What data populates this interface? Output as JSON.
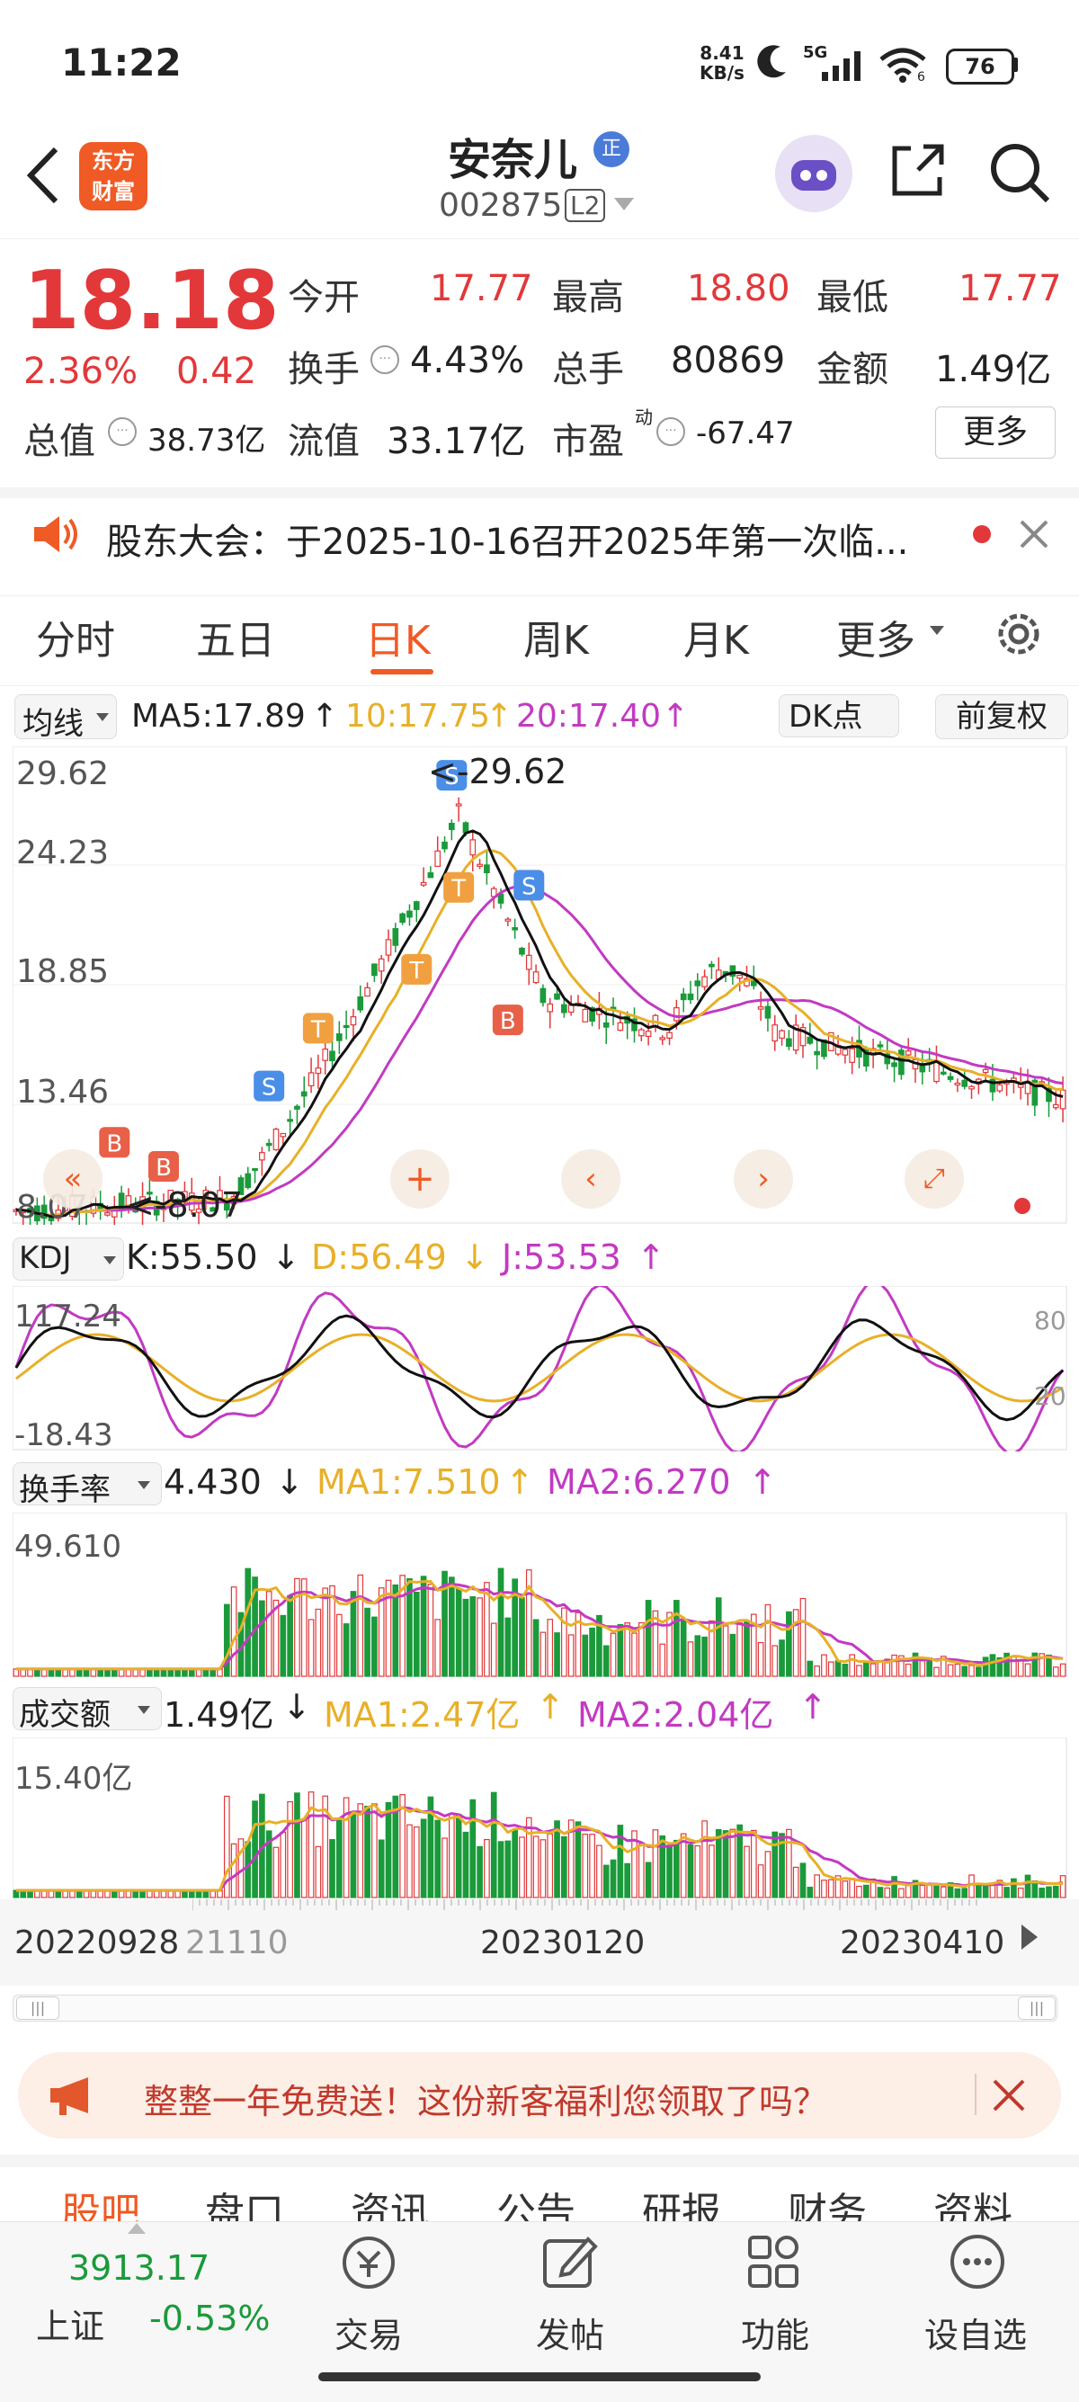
{
  "status_bar": {
    "time": "11:22",
    "net_speed_value": "8.41",
    "net_speed_unit": "KB/s",
    "signal": "5G",
    "wifi_sub": "6",
    "battery": "76"
  },
  "header": {
    "stock_name": "安奈儿",
    "stock_code": "002875",
    "level": "L2",
    "logo_line1": "东方",
    "logo_line2": "财富",
    "badge": "正"
  },
  "quote": {
    "price": "18.18",
    "change_pct": "2.36%",
    "change": "0.42",
    "open_label": "今开",
    "open": "17.77",
    "high_label": "最高",
    "high": "18.80",
    "low_label": "最低",
    "low": "17.77",
    "turnover_label": "换手",
    "turnover": "4.43%",
    "volume_label": "总手",
    "volume": "80869",
    "amount_label": "金额",
    "amount": "1.49亿",
    "mktcap_label": "总值",
    "mktcap": "38.73亿",
    "float_label": "流值",
    "float": "33.17亿",
    "pe_label": "市盈",
    "pe_sup": "动",
    "pe": "-67.47",
    "more_button": "更多"
  },
  "notice": {
    "text": "股东大会：于2025-10-16召开2025年第一次临..."
  },
  "tabs": [
    "分时",
    "五日",
    "日K",
    "周K",
    "月K",
    "更多"
  ],
  "active_tab": "日K",
  "kline": {
    "selector": "均线",
    "ma5": "MA5:17.89",
    "ma10": "10:17.75",
    "ma20": "20:17.40",
    "dk_button": "DK点",
    "adjust_button": "前复权",
    "y_labels": [
      "29.62",
      "24.23",
      "18.85",
      "13.46",
      "8.07"
    ],
    "max_label": "<-29.62",
    "min_label": "<-8.07",
    "markers": [
      "S",
      "S",
      "S",
      "B",
      "B",
      "B",
      "B",
      "T",
      "T",
      "T"
    ]
  },
  "kdj": {
    "selector": "KDJ",
    "k": "K:55.50",
    "d": "D:56.49",
    "j": "J:53.53",
    "y_top": "117.24",
    "y_bottom": "-18.43",
    "right_top": "80",
    "right_bottom": "20"
  },
  "turnover_panel": {
    "selector": "换手率",
    "value": "4.430",
    "ma1": "MA1:7.510",
    "ma2": "MA2:6.270",
    "y_top": "49.610"
  },
  "amount_panel": {
    "selector": "成交额",
    "value": "1.49亿",
    "ma1": "MA1:2.47亿",
    "ma2": "MA2:2.04亿",
    "y_top": "15.40亿"
  },
  "dates": [
    "20220928",
    "21110",
    "20230120",
    "20230410"
  ],
  "promo": {
    "text": "整整一年免费送！这份新客福利您领取了吗？"
  },
  "subtabs": [
    "股吧",
    "盘口",
    "资讯",
    "公告",
    "研报",
    "财务",
    "资料"
  ],
  "bottom_nav": {
    "index_value": "3913.17",
    "index_name": "上证",
    "index_change": "-0.53%",
    "items": [
      "交易",
      "发帖",
      "功能",
      "设自选"
    ]
  },
  "colors": {
    "up": "#e2383a",
    "down": "#1a9a3a",
    "ma10": "#e8b028",
    "ma20": "#c23ac2",
    "accent": "#f05a24"
  }
}
